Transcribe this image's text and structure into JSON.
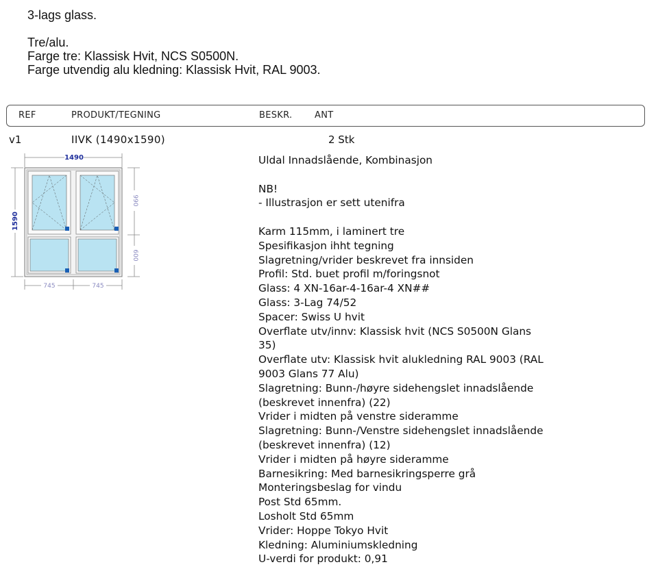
{
  "intro": {
    "glass": "3-lags glass.",
    "material": "Tre/alu.",
    "color_wood": "Farge tre: Klassisk Hvit, NCS S0500N.",
    "color_alu": "Farge utvendig alu kledning: Klassisk Hvit, RAL 9003."
  },
  "table": {
    "headers": {
      "ref": "REF",
      "product": "PRODUKT/TEGNING",
      "descr": "BESKR.",
      "qty": "ANT"
    },
    "row": {
      "ref": "v1",
      "product": "IIVK (1490x1590)",
      "qty": "2 Stk"
    }
  },
  "drawing": {
    "width_label": "1490",
    "height_label": "1590",
    "upper_height_label": "990",
    "lower_height_label": "600",
    "left_width_label": "745",
    "right_width_label": "745"
  },
  "description": {
    "title": "Uldal Innadslående, Kombinasjon",
    "note_head": "NB!",
    "note": "- Illustrasjon er sett utenifra",
    "lines": [
      "Karm 115mm, i laminert tre",
      "Spesifikasjon ihht tegning",
      "Slagretning/vrider beskrevet fra innsiden",
      "Profil: Std. buet profil m/foringsnot",
      "Glass: 4 XN-16ar-4-16ar-4 XN##",
      "Glass: 3-Lag 74/52",
      "Spacer: Swiss U hvit",
      "Overflate utv/innv: Klassisk hvit (NCS S0500N Glans",
      "35)",
      "Overflate utv: Klassisk hvit alukledning RAL 9003 (RAL",
      "9003 Glans 77 Alu)",
      "Slagretning: Bunn-/høyre sidehengslet innadslående",
      "(beskrevet innenfra) (22)",
      "Vrider i midten på venstre sideramme",
      "Slagretning: Bunn-/Venstre sidehengslet innadslående",
      "(beskrevet innenfra) (12)",
      "Vrider i midten på høyre sideramme",
      "Barnesikring: Med barnesikringsperre grå",
      "Monteringsbeslag for vindu",
      "Post Std 65mm.",
      "Losholt Std 65mm",
      "Vrider: Hoppe Tokyo Hvit",
      "Kledning: Aluminiumskledning",
      "U-verdi for produkt: 0,91"
    ]
  },
  "colors": {
    "glass": "#b9e3f2",
    "frame": "#888888",
    "handle": "#1a5fb4",
    "dimension_blue": "#1f2f9c",
    "dimension_gray": "#8a8ac0"
  }
}
